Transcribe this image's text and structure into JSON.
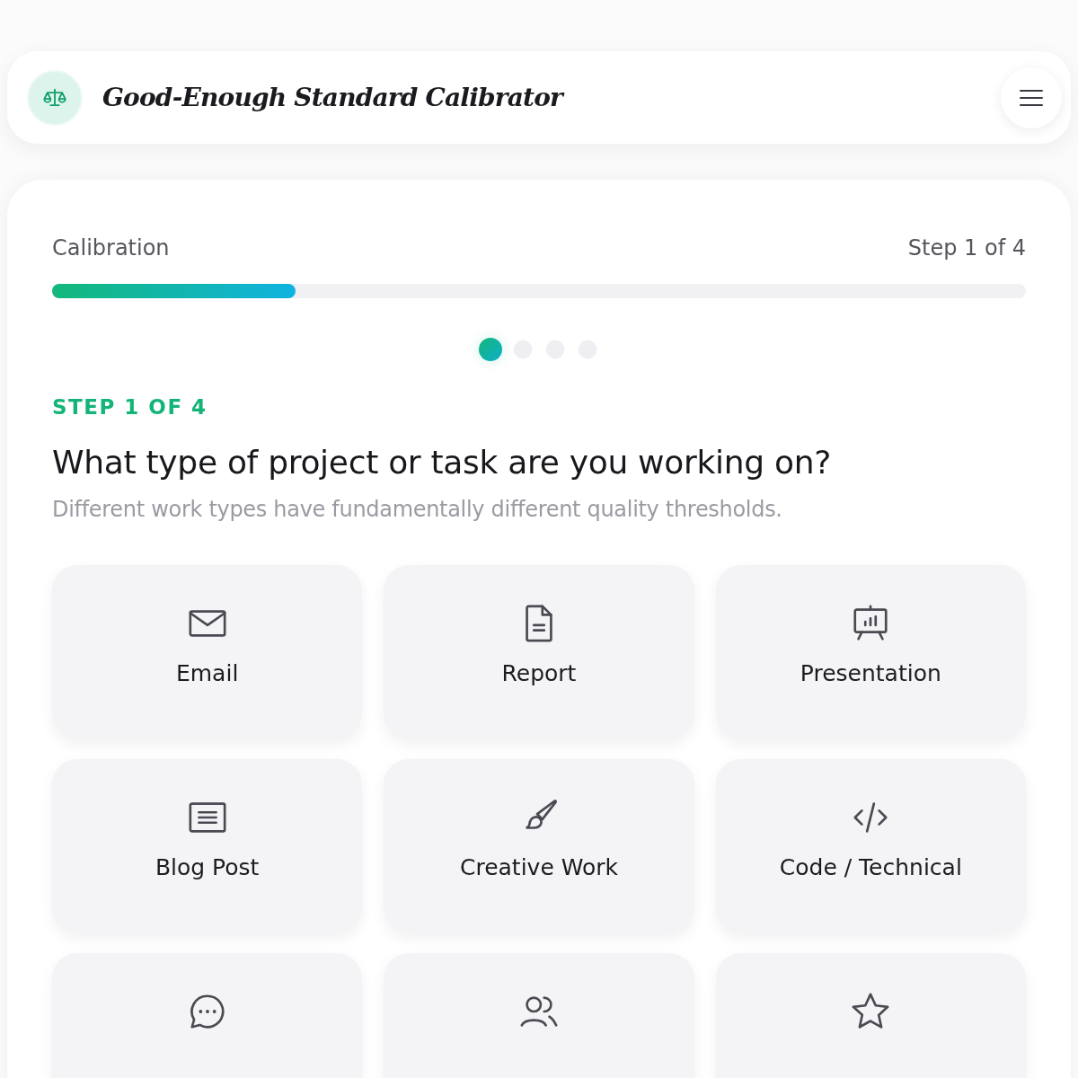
{
  "header": {
    "title": "Good-Enough Standard Calibrator"
  },
  "progress": {
    "label": "Calibration",
    "step_text": "Step 1 of 4",
    "level": 0.25
  },
  "steps": [
    {
      "selected": true
    },
    {
      "selected": false
    },
    {
      "selected": false
    },
    {
      "selected": false
    }
  ],
  "question": {
    "eyebrow": "STEP 1 OF 4",
    "title": "What type of project or task are you working on?",
    "subtitle": "Different work types have fundamentally different quality thresholds."
  },
  "options": [
    {
      "kind": "envelope",
      "label": "Email"
    },
    {
      "kind": "document",
      "label": "Report"
    },
    {
      "kind": "easel",
      "label": "Presentation"
    },
    {
      "kind": "lines",
      "label": "Blog Post"
    },
    {
      "kind": "brush",
      "label": "Creative Work"
    },
    {
      "kind": "code",
      "label": "Code / Technical"
    },
    {
      "kind": "chat"
    },
    {
      "kind": "people"
    },
    {
      "kind": "star"
    }
  ]
}
